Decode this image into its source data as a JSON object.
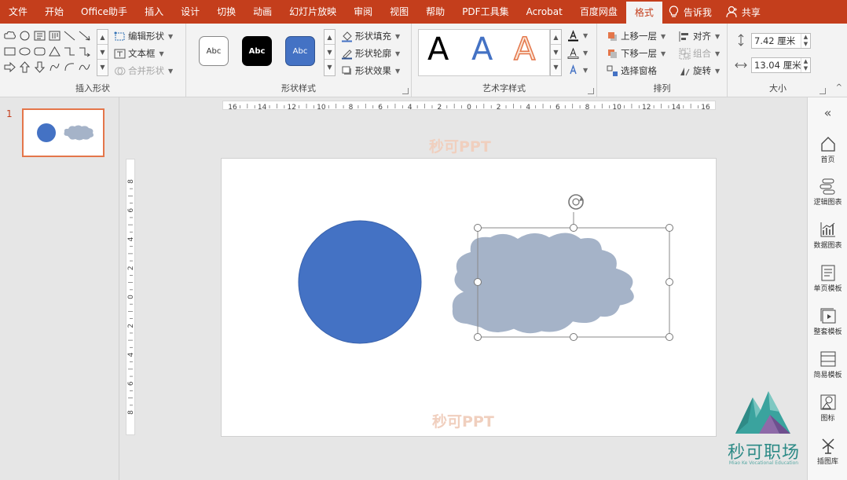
{
  "tabs": [
    "文件",
    "开始",
    "Office助手",
    "插入",
    "设计",
    "切换",
    "动画",
    "幻灯片放映",
    "审阅",
    "视图",
    "帮助",
    "PDF工具集",
    "Acrobat",
    "百度网盘",
    "格式"
  ],
  "active_tab": "格式",
  "tell_me": "告诉我",
  "share": "共享",
  "ribbon": {
    "insert_shapes": {
      "label": "插入形状",
      "edit_shape": "编辑形状",
      "text_box": "文本框",
      "merge_shapes": "合并形状"
    },
    "shape_styles": {
      "label": "形状样式",
      "sample_text": "Abc",
      "fill": "形状填充",
      "outline": "形状轮廓",
      "effects": "形状效果"
    },
    "wordart": {
      "label": "艺术字样式",
      "letter": "A"
    },
    "arrange": {
      "label": "排列",
      "bring_forward": "上移一层",
      "send_backward": "下移一层",
      "selection_pane": "选择窗格",
      "align": "对齐",
      "group": "组合",
      "rotate": "旋转"
    },
    "size": {
      "label": "大小",
      "height": "7.42 厘米",
      "width": "13.04 厘米"
    }
  },
  "slide_number": "1",
  "watermark": "秒可PPT",
  "hruler_labels": [
    "16",
    "14",
    "12",
    "10",
    "8",
    "6",
    "4",
    "2",
    "0",
    "2",
    "4",
    "6",
    "8",
    "10",
    "12",
    "14",
    "16"
  ],
  "vruler_labels": [
    "8",
    "6",
    "4",
    "2",
    "0",
    "2",
    "4",
    "6",
    "8"
  ],
  "side_pane": {
    "collapse": "«",
    "items": [
      "首页",
      "逻辑图表",
      "数据图表",
      "单页模板",
      "整套模板",
      "简易模板",
      "图标",
      "插图库"
    ]
  },
  "brand": {
    "name": "秒可职场",
    "sub": "Miao Ke Vocational Education"
  },
  "colors": {
    "accent": "#c43e1c",
    "circle": "#4472c4",
    "cloud": "#a5b3c8"
  }
}
